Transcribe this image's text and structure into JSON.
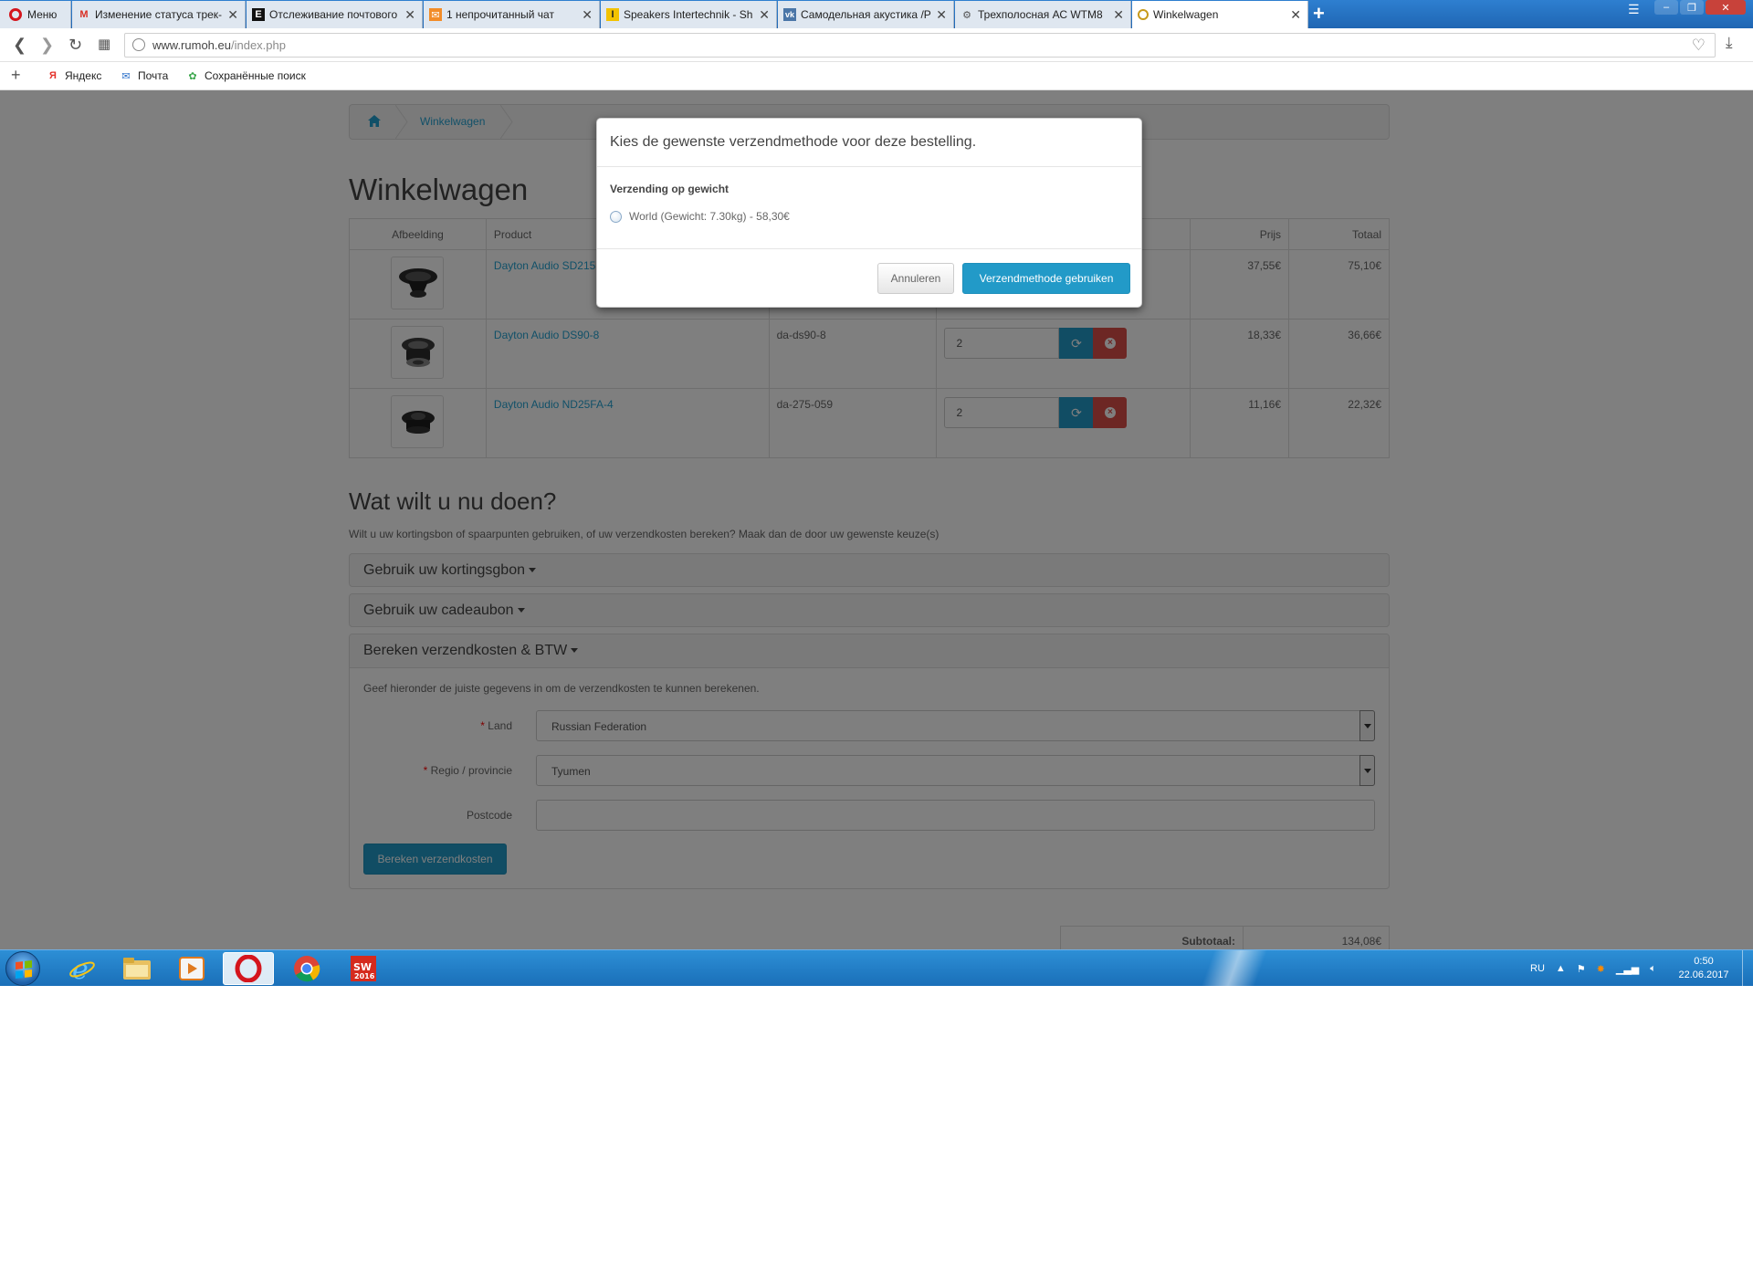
{
  "browser": {
    "menu_label": "Меню",
    "tabs": [
      {
        "title": "Изменение статуса трек-",
        "icon": "gmail-icon"
      },
      {
        "title": "Отслеживание почтового",
        "icon": "tracking-icon"
      },
      {
        "title": "1 непрочитанный чат",
        "icon": "mail-icon"
      },
      {
        "title": "Speakers Intertechnik - Sh",
        "icon": "intertechnik-icon"
      },
      {
        "title": "Самодельная акустика /Р",
        "icon": "vk-icon"
      },
      {
        "title": "Трехполосная АС WTM8",
        "icon": "forum-icon"
      },
      {
        "title": "Winkelwagen",
        "icon": "rumoh-icon",
        "active": true
      }
    ],
    "url_domain": "www.rumoh.eu",
    "url_path": "/index.php",
    "bookmarks": [
      {
        "label": "Яндекс",
        "icon": "yandex-icon"
      },
      {
        "label": "Почта",
        "icon": "mail-icon"
      },
      {
        "label": "Сохранённые поиск",
        "icon": "saved-searches-icon"
      }
    ]
  },
  "page": {
    "breadcrumb": {
      "current": "Winkelwagen"
    },
    "title": "Winkelwagen",
    "cart": {
      "headers": {
        "image": "Afbeelding",
        "product": "Product",
        "price": "Prijs",
        "total": "Totaal"
      },
      "rows": [
        {
          "product": "Dayton Audio SD215",
          "model": "",
          "qty": "",
          "price": "37,55€",
          "total": "75,10€"
        },
        {
          "product": "Dayton Audio DS90-8",
          "model": "da-ds90-8",
          "qty": "2",
          "price": "18,33€",
          "total": "36,66€"
        },
        {
          "product": "Dayton Audio ND25FA-4",
          "model": "da-275-059",
          "qty": "2",
          "price": "11,16€",
          "total": "22,32€"
        }
      ]
    },
    "next": {
      "title": "Wat wilt u nu doen?",
      "description": "Wilt u uw kortingsbon of spaarpunten gebruiken, of uw verzendkosten bereken? Maak dan de door uw gewenste keuze(s)",
      "coupon_label": "Gebruik uw kortingsgbon",
      "voucher_label": "Gebruik uw cadeaubon",
      "shipping_label": "Bereken verzendkosten & BTW"
    },
    "shipping": {
      "description": "Geef hieronder de juiste gegevens in om de verzendkosten te kunnen berekenen.",
      "country_label": "Land",
      "country_value": "Russian Federation",
      "region_label": "Regio / provincie",
      "region_value": "Tyumen",
      "postcode_label": "Postcode",
      "postcode_value": "",
      "button_label": "Bereken verzendkosten"
    },
    "totals": {
      "subtotal_label": "Subtotaal:",
      "subtotal_value": "134,08€"
    }
  },
  "modal": {
    "title": "Kies de gewenste verzendmethode voor deze bestelling.",
    "group_label": "Verzending op gewicht",
    "option_label": "World (Gewicht: 7.30kg) - 58,30€",
    "option_selected": false,
    "cancel_label": "Annuleren",
    "confirm_label": "Verzendmethode gebruiken"
  },
  "taskbar": {
    "apps": [
      "internet-explorer-icon",
      "file-explorer-icon",
      "media-player-icon",
      "opera-icon",
      "chrome-icon",
      "solidworks-icon"
    ],
    "solidworks_label": "2016",
    "language": "RU",
    "time": "0:50",
    "date": "22.06.2017"
  },
  "colors": {
    "primary": "#229ac8",
    "danger": "#da4f49",
    "link": "#23a1d1",
    "taskbar": "#1f6fb8"
  }
}
